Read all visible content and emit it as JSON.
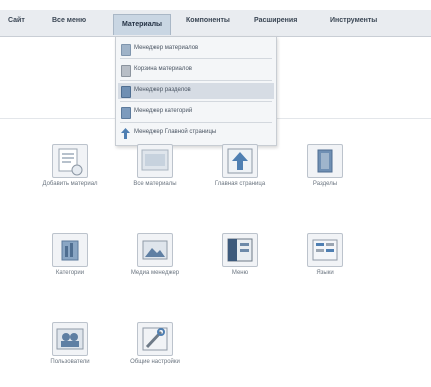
{
  "menubar": {
    "items": [
      "Сайт",
      "Все меню",
      "Материалы",
      "Компоненты",
      "Расширения",
      "Инструменты"
    ],
    "active_index": 2
  },
  "dropdown": {
    "items": [
      {
        "label": "Менеджер материалов",
        "icon": "document-icon"
      },
      {
        "label": "Корзина материалов",
        "icon": "trash-icon"
      },
      {
        "label": "Менеджер разделов",
        "icon": "sections-icon"
      },
      {
        "label": "Менеджер категорий",
        "icon": "categories-icon"
      },
      {
        "label": "Менеджер Главной страницы",
        "icon": "frontpage-icon"
      }
    ],
    "selected_index": 2
  },
  "tiles": [
    {
      "label": "Добавить материал",
      "icon": "add-article-icon"
    },
    {
      "label": "Все материалы",
      "icon": "articles-icon"
    },
    {
      "label": "Главная страница",
      "icon": "frontpage-icon"
    },
    {
      "label": "Разделы",
      "icon": "sections-icon"
    },
    {
      "label": "Категории",
      "icon": "categories-icon"
    },
    {
      "label": "Медиа менеджер",
      "icon": "media-icon"
    },
    {
      "label": "Меню",
      "icon": "menu-icon"
    },
    {
      "label": "Языки",
      "icon": "language-icon"
    },
    {
      "label": "Пользователи",
      "icon": "users-icon"
    },
    {
      "label": "Общие настройки",
      "icon": "settings-icon"
    }
  ],
  "colors": {
    "menubar_bg": "#e9ecf0",
    "active_tab_bg": "#c9d6e3",
    "dropdown_selected_bg": "#d6dce4",
    "icon_blue": "#4f7fb2"
  }
}
